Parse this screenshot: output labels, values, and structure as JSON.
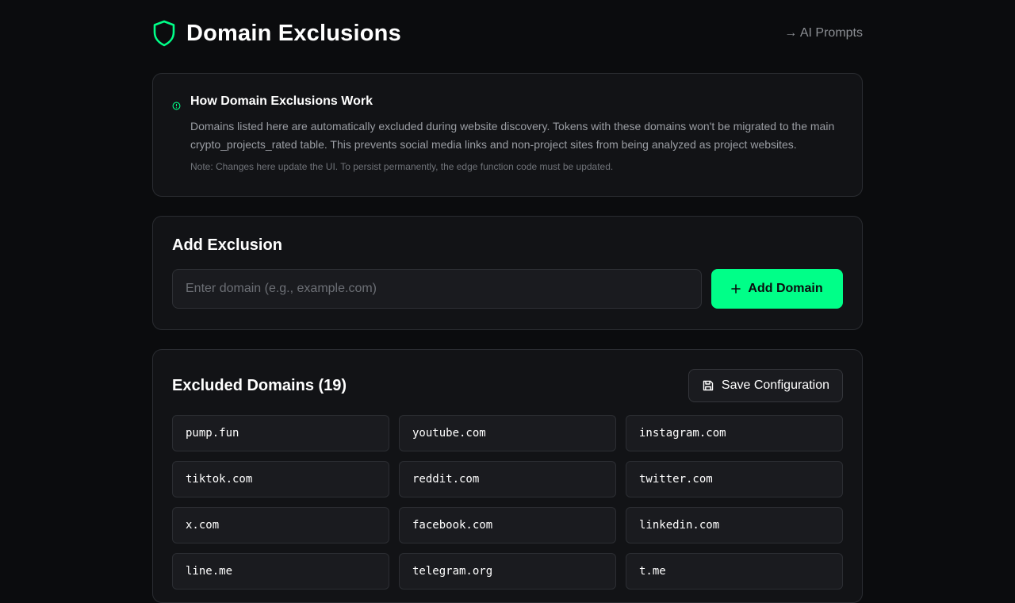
{
  "header": {
    "title": "Domain Exclusions",
    "nav_link": "→ AI Prompts",
    "icon": "shield-icon",
    "accent_color": "#00ff88"
  },
  "info": {
    "icon": "info-icon",
    "title": "How Domain Exclusions Work",
    "body": "Domains listed here are automatically excluded during website discovery. Tokens with these domains won't be migrated to the main crypto_projects_rated table. This prevents social media links and non-project sites from being analyzed as project websites.",
    "note": "Note: Changes here update the UI. To persist permanently, the edge function code must be updated."
  },
  "add_exclusion": {
    "title": "Add Exclusion",
    "input_value": "",
    "input_placeholder": "Enter domain (e.g., example.com)",
    "button_label": "Add Domain",
    "button_icon": "plus-icon"
  },
  "excluded": {
    "title": "Excluded Domains (19)",
    "save_label": "Save Configuration",
    "save_icon": "save-icon",
    "domains": [
      "pump.fun",
      "youtube.com",
      "instagram.com",
      "tiktok.com",
      "reddit.com",
      "twitter.com",
      "x.com",
      "facebook.com",
      "linkedin.com",
      "line.me",
      "telegram.org",
      "t.me"
    ]
  }
}
